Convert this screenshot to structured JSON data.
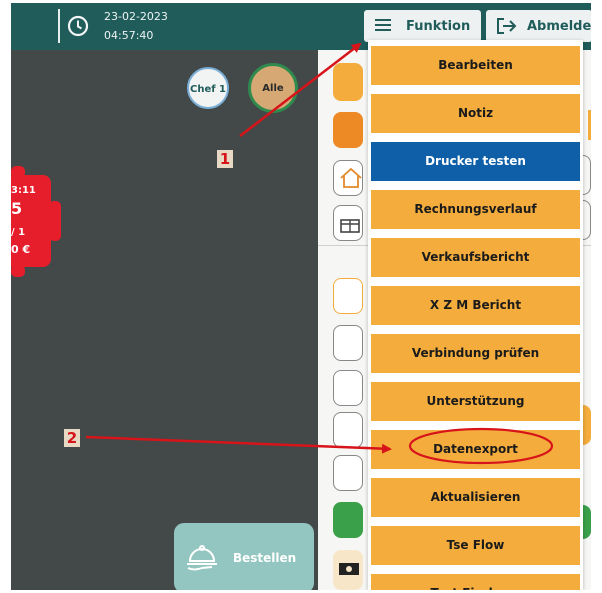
{
  "header": {
    "date": "23-02-2023",
    "time": "04:57:40",
    "funktion_label": "Funktion",
    "abmelden_label": "Abmelden"
  },
  "staff_filters": [
    {
      "label": "Chef 1"
    },
    {
      "label": "Alle"
    }
  ],
  "table_card": {
    "time_partial": "3:11",
    "number_partial": "5",
    "guests_partial": "/ 1",
    "amount_partial": "0 €",
    "color": "#e61e2b"
  },
  "bestellen_label": "Bestellen",
  "function_menu": {
    "items": [
      {
        "label": "Bearbeiten"
      },
      {
        "label": "Notiz"
      },
      {
        "label": "Drucker testen"
      },
      {
        "label": "Rechnungsverlauf"
      },
      {
        "label": "Verkaufsbericht"
      },
      {
        "label": "X Z M Bericht"
      },
      {
        "label": "Verbindung prüfen"
      },
      {
        "label": "Unterstützung"
      },
      {
        "label": "Datenexport"
      },
      {
        "label": "Aktualisieren"
      },
      {
        "label": "Tse Flow"
      },
      {
        "label": "Test Firebase"
      }
    ],
    "highlighted": "Drucker testen",
    "item_color": "#f4ad3d",
    "highlight_color": "#0e5fa8"
  },
  "annotations": [
    {
      "label": "1"
    },
    {
      "label": "2"
    }
  ],
  "colors": {
    "header_bg": "#1f5c5a",
    "canvas_bg": "#434848",
    "annotation": "#d7141a"
  }
}
